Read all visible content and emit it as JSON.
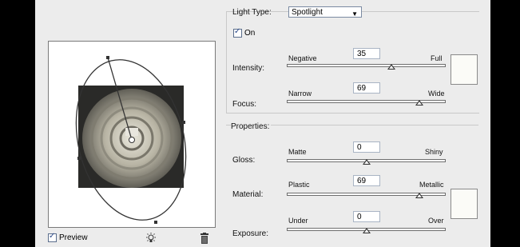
{
  "light": {
    "type_label": "Light Type:",
    "type_value": "Spotlight",
    "on_label": "On",
    "intensity": {
      "label": "Intensity:",
      "min": "Negative",
      "max": "Full",
      "value": "35",
      "fraction": 0.68
    },
    "focus": {
      "label": "Focus:",
      "min": "Narrow",
      "max": "Wide",
      "value": "69",
      "fraction": 0.85
    }
  },
  "properties": {
    "title": "Properties:",
    "gloss": {
      "label": "Gloss:",
      "min": "Matte",
      "max": "Shiny",
      "value": "0",
      "fraction": 0.5
    },
    "material": {
      "label": "Material:",
      "min": "Plastic",
      "max": "Metallic",
      "value": "69",
      "fraction": 0.85
    },
    "exposure": {
      "label": "Exposure:",
      "min": "Under",
      "max": "Over",
      "value": "0",
      "fraction": 0.5
    }
  },
  "footer": {
    "preview_label": "Preview"
  },
  "colors": {
    "swatch": "#fbfbf7",
    "panel": "#ececec"
  },
  "icons": {
    "bulb": "light-bulb-icon",
    "trash": "trash-icon"
  }
}
